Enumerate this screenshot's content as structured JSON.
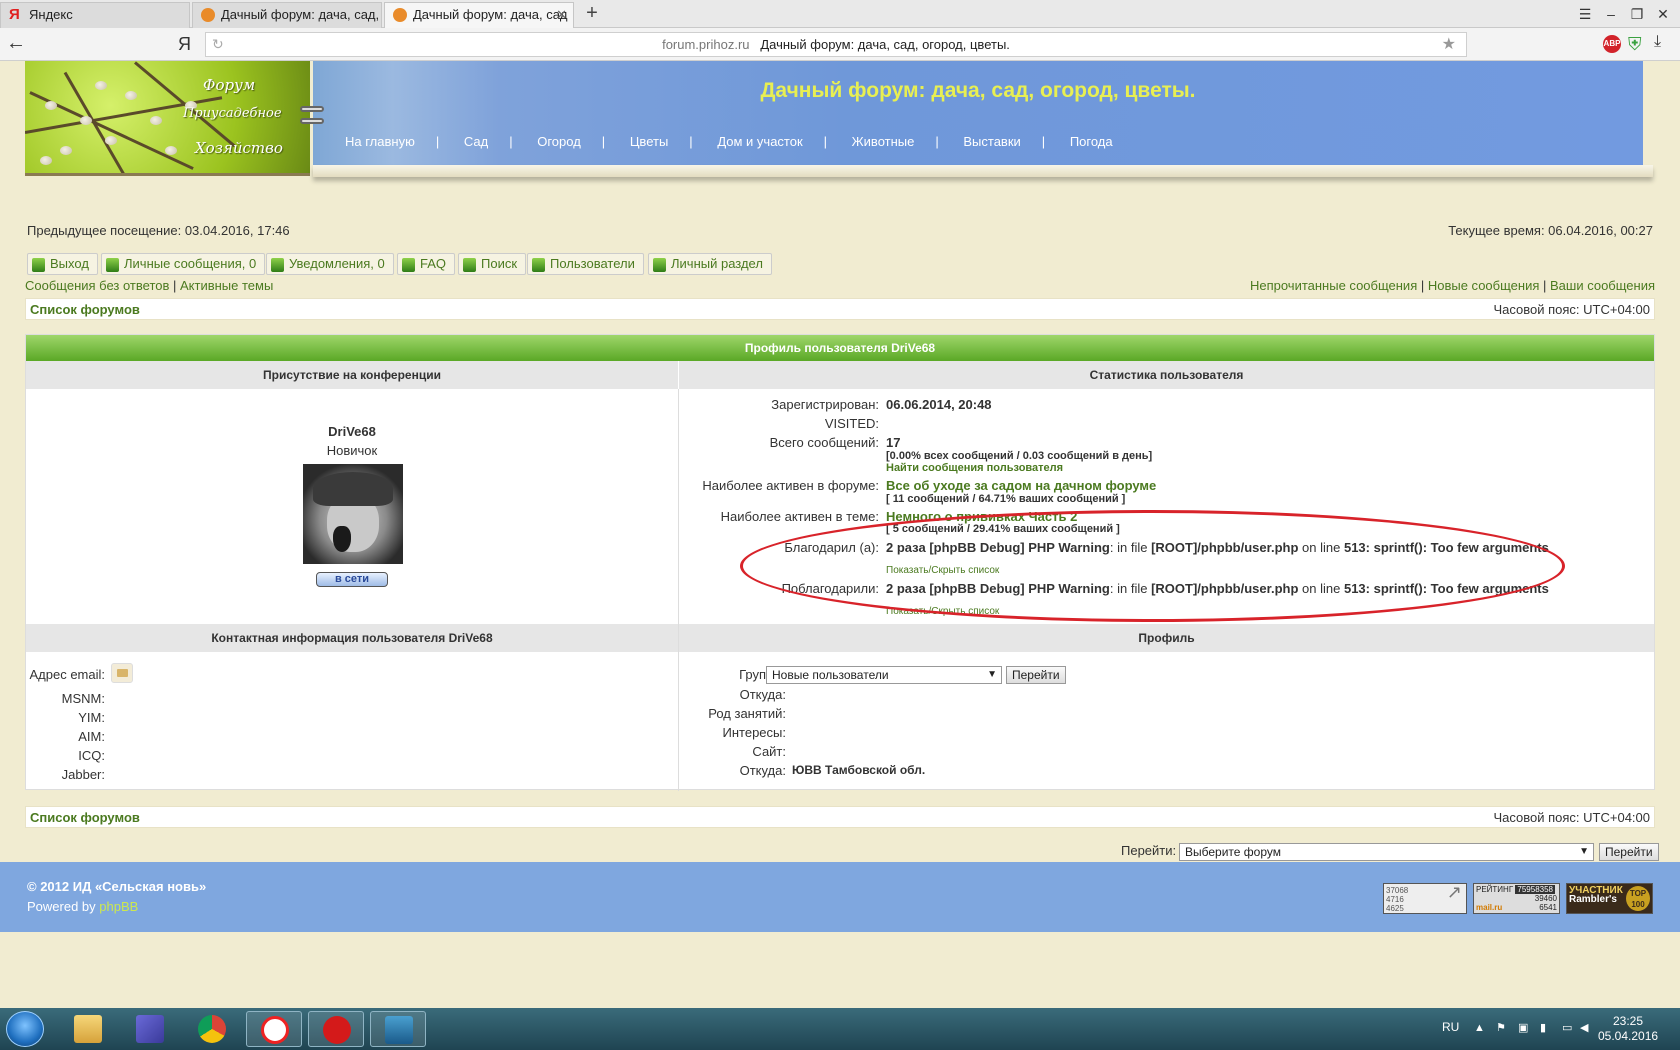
{
  "browser": {
    "tabs": [
      {
        "label": "Яндекс",
        "icon": "yandex-icon"
      },
      {
        "label": "Дачный форум: дача, сад, ог",
        "icon": "site-favicon"
      },
      {
        "label": "Дачный форум: дача, сад",
        "icon": "site-favicon"
      }
    ],
    "url_host": "forum.prihoz.ru",
    "url_title": "Дачный форум: дача, сад, огород, цветы.",
    "ya_logo": "Я",
    "abp_label": "ABP"
  },
  "header": {
    "logo_lines": [
      "Форум",
      "Приусадебное",
      "Хозяйство"
    ],
    "title": "Дачный форум: дача, сад, огород, цветы.",
    "nav": [
      "На главную",
      "Сад",
      "Огород",
      "Цветы",
      "Дом и участок",
      "Животные",
      "Выставки",
      "Погода"
    ]
  },
  "info": {
    "last_visit": "Предыдущее посещение: 03.04.2016, 17:46",
    "current_time": "Текущее время: 06.04.2016, 00:27"
  },
  "nav_buttons": [
    "Выход",
    "Личные сообщения, 0",
    "Уведомления, 0",
    "FAQ",
    "Поиск",
    "Пользователи",
    "Личный раздел"
  ],
  "quick_links_left": [
    "Сообщения без ответов",
    "Активные темы"
  ],
  "quick_links_right": [
    "Непрочитанные сообщения",
    "Новые сообщения",
    "Ваши сообщения"
  ],
  "breadcrumb": {
    "label": "Список форумов",
    "timezone": "Часовой пояс: UTC+04:00"
  },
  "profile": {
    "heading": "Профиль пользователя DriVe68",
    "presence_heading": "Присутствие на конференции",
    "stats_heading": "Статистика пользователя",
    "username": "DriVe68",
    "rank": "Новичок",
    "online": "в сети",
    "stats": {
      "registered_label": "Зарегистрирован:",
      "registered_value": "06.06.2014, 20:48",
      "visited_label": "VISITED:",
      "posts_label": "Всего сообщений:",
      "posts_value": "17",
      "posts_detail": "[0.00% всех сообщений / 0.03 сообщений в день]",
      "posts_search": "Найти сообщения пользователя",
      "active_forum_label": "Наиболее активен в форуме:",
      "active_forum_value": "Все об уходе за садом на дачном форуме",
      "active_forum_detail": "[ 11 сообщений / 64.71% ваших сообщений ]",
      "active_topic_label": "Наиболее активен в теме:",
      "active_topic_value": "Немного о прививках Часть 2",
      "active_topic_detail": "[ 5 сообщений / 29.41% ваших сообщений ]",
      "thanked_label": "Благодарил (а):",
      "thanked_prefix": "2 раза",
      "warn_a": "[phpBB Debug] PHP Warning",
      "warn_b": ": in file",
      "warn_c": "[ROOT]/phpbb/user.php",
      "warn_d": "on line",
      "warn_e": "513",
      "warn_f": ": sprintf(): Too few arguments",
      "toggle_list": "Показать/Скрыть список",
      "thanked_by_label": "Поблагодарили:",
      "thanked_by_prefix": "2 раза",
      "toggle_list2": "Показать/Скрыть список"
    },
    "contact_heading": "Контактная информация пользователя DriVe68",
    "profile_heading": "Профиль",
    "contact_labels": [
      "Адрес email:",
      "MSNM:",
      "YIM:",
      "AIM:",
      "ICQ:",
      "Jabber:"
    ],
    "groups_label": "Группы:",
    "groups_value": "Новые пользователи",
    "go_button": "Перейти",
    "profile_labels": [
      "Откуда:",
      "Род занятий:",
      "Интересы:",
      "Сайт:",
      "Откуда:"
    ],
    "from_value": "ЮВВ Тамбовской обл."
  },
  "bottom": {
    "breadcrumb": "Список форумов",
    "timezone": "Часовой пояс: UTC+04:00",
    "jump_label": "Перейти:",
    "jump_select": "Выберите форум",
    "jump_button": "Перейти"
  },
  "footer": {
    "copyright": "© 2012 ИД «Сельская новь»",
    "powered_prefix": "Powered by",
    "powered_link": "phpBB",
    "counters": [
      "37068",
      "4716",
      "4625",
      "РЕЙТИНГ",
      "75958358",
      "39460",
      "6541",
      "mail.ru",
      "УЧАСТНИК",
      "Rambler's",
      "TOP",
      "100"
    ]
  },
  "taskbar": {
    "lang": "RU",
    "time": "23:25",
    "date": "05.04.2016"
  }
}
